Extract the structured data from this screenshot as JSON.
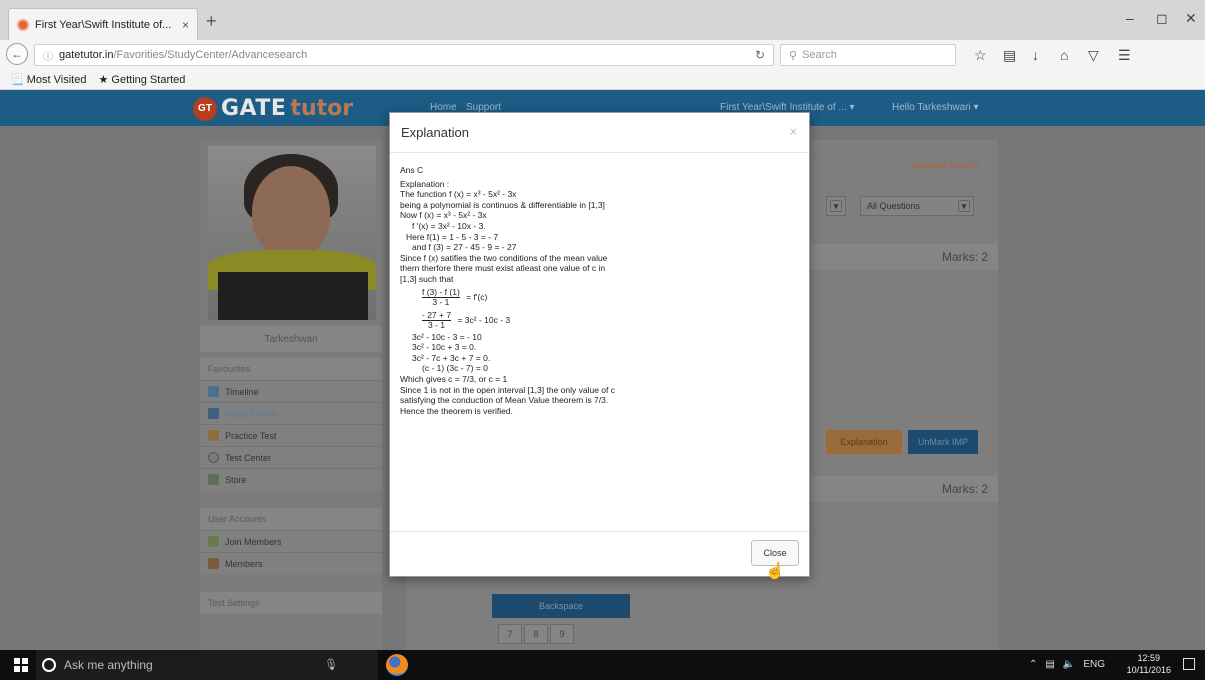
{
  "browser": {
    "tab_title": "First Year\\Swift Institute of...",
    "tab_close": "×",
    "new_tab": "+",
    "url_host": "gatetutor.in",
    "url_path": "/Favorities/StudyCenter/Advancesearch",
    "search_placeholder": "Search",
    "bookmarks": [
      "Most Visited",
      "Getting Started"
    ]
  },
  "site": {
    "logo_badge": "GT",
    "logo_main": "GATE",
    "logo_tutor": "tutor",
    "nav": [
      "Home",
      "Support"
    ],
    "institute_menu": "First Year\\Swift Institute of ... ▾",
    "user_menu": "Hello Tarkeshwari ▾"
  },
  "sidebar": {
    "user_name": "Tarkeshwari",
    "favorites_heading": "Favourites",
    "favorites": [
      "Timeline",
      "Study Center",
      "Practice Test",
      "Test Center",
      "Store"
    ],
    "accounts_heading": "User Accounts",
    "accounts": [
      "Join Members",
      "Members"
    ],
    "settings_heading": "Test Settings"
  },
  "main": {
    "advance_search": "Advance Search",
    "select_questions": "All Questions",
    "marks_1": "Marks: 2",
    "marks_2": "Marks: 2",
    "explanation_btn": "Explanation",
    "unmark_btn": "UnMark IMP",
    "backspace_btn": "Backspace",
    "keypad": [
      "7",
      "8",
      "9"
    ]
  },
  "modal": {
    "title": "Explanation",
    "close_x": "×",
    "lines": [
      "Ans C",
      "Explanation :",
      "The function  f (x) = x³ - 5x² - 3x",
      "being   a polynomial is continuos & differentiable in [1,3]",
      "Now f (x) = x³ - 5x² - 3x",
      "f '(x) = 3x² - 10x - 3.",
      "Here f(1) = 1 - 5 - 3 = - 7",
      "and f (3) = 27 - 45 - 9 = - 27",
      "Since f (x) satifies the two conditions of the mean value",
      "thern therfore there must exist atleast one value of c in",
      "[1,3] such that",
      "f (3) - f (1)",
      "3 - 1",
      "= f'(c)",
      "- 27 + 7",
      "3 - 1",
      "= 3c² - 10c - 3",
      "3c² - 10c - 3  = - 10",
      "3c² - 10c + 3  = 0.",
      "3c² - 7c + 3c + 7 = 0.",
      "(c - 1) (3c - 7) = 0",
      "Which gives  c = 7/3, or c = 1",
      "Since 1 is not in the open interval [1,3] the only value of c",
      "satisfying the conduction of Mean Value theorem is  7/3.",
      "Hence the theorem is verified."
    ],
    "close_btn": "Close"
  },
  "taskbar": {
    "search_placeholder": "Ask me anything",
    "lang": "ENG",
    "time": "12:59",
    "date": "10/11/2016"
  }
}
